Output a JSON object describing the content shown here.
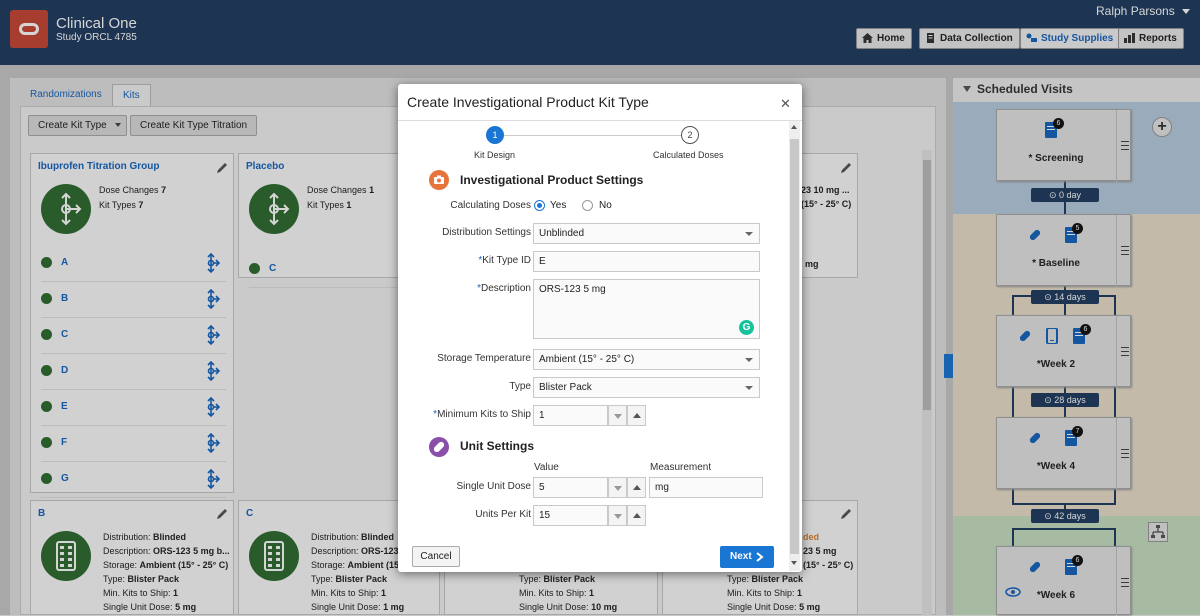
{
  "header": {
    "app_title": "Clinical One",
    "study_name": "Study ORCL 4785",
    "user_name": "Ralph Parsons",
    "nav": [
      {
        "label": "Home",
        "icon": "home-icon"
      },
      {
        "label": "Data Collection",
        "icon": "document-icon"
      },
      {
        "label": "Study Supplies",
        "icon": "supplies-icon",
        "active": true
      },
      {
        "label": "Reports",
        "icon": "bar-chart-icon"
      }
    ]
  },
  "tabs": [
    {
      "label": "Randomizations"
    },
    {
      "label": "Kits",
      "active": true
    }
  ],
  "toolbar": {
    "create_kit_type": "Create Kit Type",
    "create_titration": "Create Kit Type Titration"
  },
  "groups": [
    {
      "title": "Ibuprofen Titration Group",
      "dose_changes_label": "Dose Changes",
      "dose_changes": "7",
      "kit_types_label": "Kit Types",
      "kit_types": "7",
      "kits": [
        "A",
        "B",
        "C",
        "D",
        "E",
        "F",
        "G"
      ]
    },
    {
      "title": "Placebo",
      "dose_changes_label": "Dose Changes",
      "dose_changes": "1",
      "kit_types_label": "Kit Types",
      "kit_types": "1",
      "kits": [
        "C"
      ]
    }
  ],
  "partial_group_text": {
    "line1": "23 10 mg ...",
    "line2": "(15° - 25° C)",
    "line3": "mg"
  },
  "kit_cards": [
    {
      "title": "B",
      "distribution": "Blinded",
      "description": "ORS-123 5 mg b...",
      "storage": "Ambient (15° - 25° C)",
      "type": "Blister Pack",
      "min_kits": "1",
      "single_unit_dose": "5 mg"
    },
    {
      "title": "C",
      "distribution": "Blinded",
      "description": "ORS-123",
      "storage": "Ambient (15",
      "type": "Blister Pack",
      "min_kits": "1",
      "single_unit_dose": "1 mg"
    },
    {
      "type": "Blister Pack",
      "min_kits": "1",
      "single_unit_dose": "10 mg"
    },
    {
      "type": "Blister Pack",
      "min_kits": "1",
      "single_unit_dose": "5 mg",
      "partial1": "ded",
      "partial2": "23 5 mg",
      "partial3": "(15° - 25° C)"
    }
  ],
  "card_labels": {
    "distribution": "Distribution:",
    "description": "Description:",
    "storage": "Storage:",
    "type": "Type:",
    "min_kits": "Min. Kits to Ship:",
    "single_unit_dose": "Single Unit Dose:"
  },
  "scheduled_visits": {
    "title": "Scheduled Visits",
    "visits": [
      {
        "name": "* Screening",
        "badge": "6",
        "band_color": "#b8cde0"
      },
      {
        "name": "* Baseline",
        "badge": "5",
        "band_color": "#eadfcb"
      },
      {
        "name": "*Week 2",
        "badge": "6",
        "band_color": "#eadfcb"
      },
      {
        "name": "*Week 4",
        "badge": "7",
        "band_color": "#eadfcb"
      },
      {
        "name": "*Week 6",
        "badge": "6",
        "band_color": "#c7dfc1"
      }
    ],
    "intervals": [
      "0 day",
      "14 days",
      "28 days",
      "42 days"
    ]
  },
  "modal": {
    "title": "Create Investigational Product Kit Type",
    "steps": [
      {
        "number": "1",
        "label": "Kit Design",
        "active": true
      },
      {
        "number": "2",
        "label": "Calculated Doses",
        "active": false
      }
    ],
    "ip_section_title": "Investigational Product Settings",
    "unit_section_title": "Unit Settings",
    "fields": {
      "calculating_doses": {
        "label": "Calculating Doses",
        "options": [
          "Yes",
          "No"
        ],
        "selected": "Yes"
      },
      "distribution_settings": {
        "label": "Distribution Settings",
        "value": "Unblinded"
      },
      "kit_type_id": {
        "label": "Kit Type ID",
        "value": "E"
      },
      "description": {
        "label": "Description",
        "value": "ORS-123 5 mg"
      },
      "storage_temperature": {
        "label": "Storage Temperature",
        "value": "Ambient (15° - 25° C)"
      },
      "type": {
        "label": "Type",
        "value": "Blister Pack"
      },
      "minimum_kits": {
        "label": "Minimum Kits to Ship",
        "value": "1"
      },
      "single_unit_dose": {
        "label": "Single Unit Dose",
        "value": "5",
        "measurement": "mg"
      },
      "units_per_kit": {
        "label": "Units Per Kit",
        "value": "15"
      }
    },
    "column_value": "Value",
    "column_measurement": "Measurement",
    "cancel_label": "Cancel",
    "next_label": "Next",
    "accent_color": "#1976d2"
  }
}
